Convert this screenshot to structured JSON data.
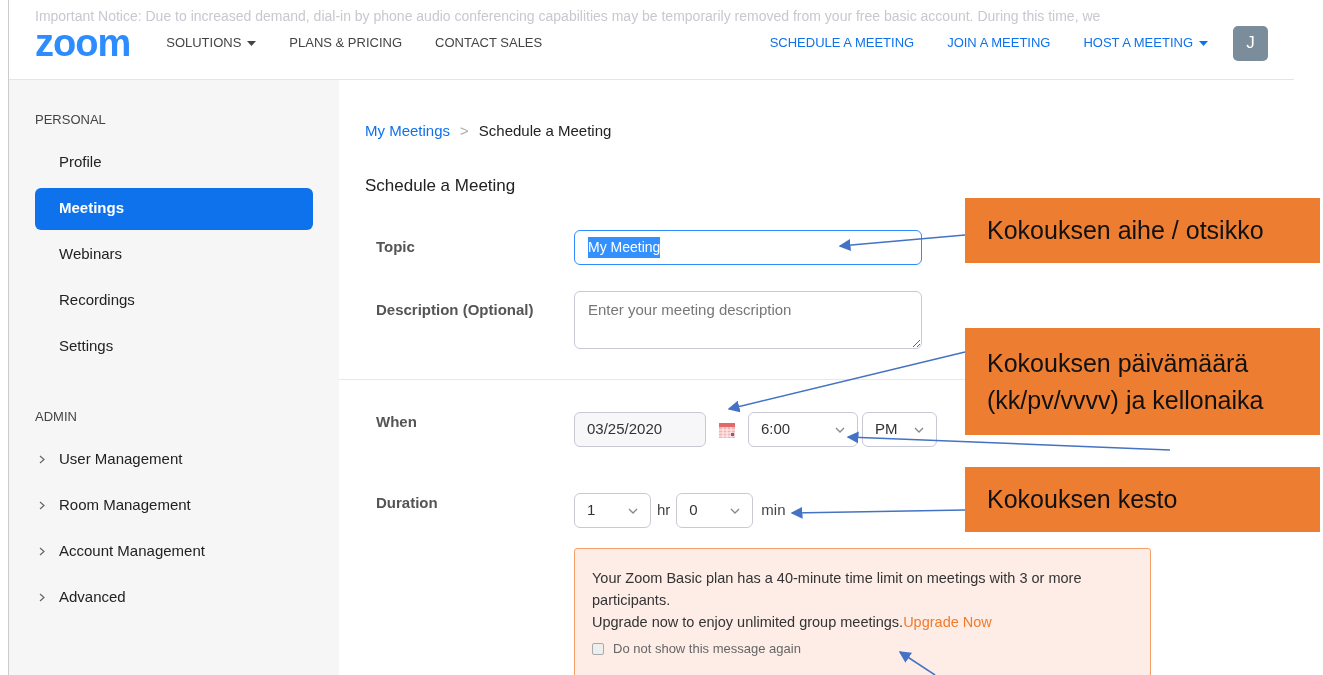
{
  "notice": "Important Notice: Due to increased demand, dial-in by phone audio conferencing capabilities may be temporarily removed from your free basic account. During this time, we",
  "header": {
    "logo": "zoom",
    "nav_left": [
      {
        "label": "SOLUTIONS",
        "dropdown": true
      },
      {
        "label": "PLANS & PRICING",
        "dropdown": false
      },
      {
        "label": "CONTACT SALES",
        "dropdown": false
      }
    ],
    "nav_right": [
      {
        "label": "SCHEDULE A MEETING",
        "dropdown": false
      },
      {
        "label": "JOIN A MEETING",
        "dropdown": false
      },
      {
        "label": "HOST A MEETING",
        "dropdown": true
      }
    ],
    "avatar": "J"
  },
  "sidebar": {
    "sections": [
      {
        "title": "PERSONAL",
        "items": [
          {
            "label": "Profile",
            "selected": false,
            "expandable": false
          },
          {
            "label": "Meetings",
            "selected": true,
            "expandable": false
          },
          {
            "label": "Webinars",
            "selected": false,
            "expandable": false
          },
          {
            "label": "Recordings",
            "selected": false,
            "expandable": false
          },
          {
            "label": "Settings",
            "selected": false,
            "expandable": false
          }
        ]
      },
      {
        "title": "ADMIN",
        "items": [
          {
            "label": "User Management",
            "selected": false,
            "expandable": true
          },
          {
            "label": "Room Management",
            "selected": false,
            "expandable": true
          },
          {
            "label": "Account Management",
            "selected": false,
            "expandable": true
          },
          {
            "label": "Advanced",
            "selected": false,
            "expandable": true
          }
        ]
      }
    ]
  },
  "breadcrumb": {
    "link": "My Meetings",
    "separator": ">",
    "current": "Schedule a Meeting"
  },
  "heading": "Schedule a Meeting",
  "form": {
    "topic": {
      "label": "Topic",
      "value": "My Meeting"
    },
    "description": {
      "label": "Description (Optional)",
      "placeholder": "Enter your meeting description"
    },
    "when": {
      "label": "When",
      "date": "03/25/2020",
      "time": "6:00",
      "ampm": "PM"
    },
    "duration": {
      "label": "Duration",
      "hours": "1",
      "hours_unit": "hr",
      "minutes": "0",
      "minutes_unit": "min"
    },
    "alert": {
      "text": "Your Zoom Basic plan has a 40-minute time limit on meetings with 3 or more participants.",
      "text2": "Upgrade now to enjoy unlimited group meetings.",
      "link": "Upgrade Now",
      "checkbox_label": "Do not show this message again",
      "checked": false
    }
  },
  "annotations": [
    {
      "text": "Kokouksen aihe / otsikko"
    },
    {
      "text": "Kokouksen päivämäärä (kk/pv/vvvv) ja kellonaika"
    },
    {
      "text": "Kokouksen kesto"
    }
  ]
}
